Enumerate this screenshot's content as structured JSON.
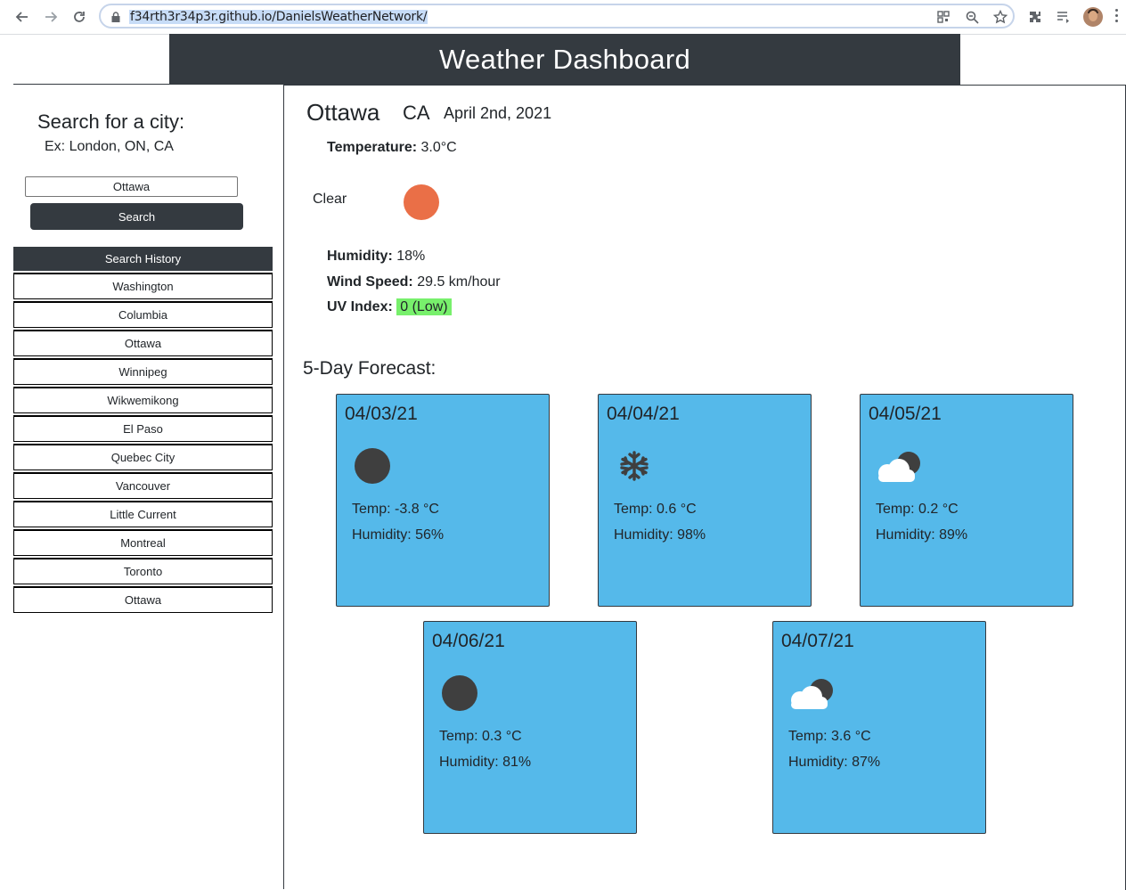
{
  "browser": {
    "url": "f34rth3r34p3r.github.io/DanielsWeatherNetwork/"
  },
  "header": {
    "title": "Weather Dashboard"
  },
  "sidebar": {
    "title": "Search for a city:",
    "example": "Ex: London, ON, CA",
    "search_value": "Ottawa",
    "search_button": "Search",
    "history_title": "Search History",
    "history": [
      "Washington",
      "Columbia",
      "Ottawa",
      "Winnipeg",
      "Wikwemikong",
      "El Paso",
      "Quebec City",
      "Vancouver",
      "Little Current",
      "Montreal",
      "Toronto",
      "Ottawa"
    ]
  },
  "current": {
    "city": "Ottawa",
    "country": "CA",
    "date": "April 2nd, 2021",
    "temperature_label": "Temperature:",
    "temperature_value": "3.0°C",
    "condition": "Clear",
    "condition_icon": "sun-icon",
    "humidity_label": "Humidity:",
    "humidity_value": "18%",
    "wind_label": "Wind Speed:",
    "wind_value": "29.5 km/hour",
    "uv_label": "UV Index:",
    "uv_value": "0 (Low)",
    "uv_color": "#78f06c",
    "sun_color": "#ea6f47"
  },
  "forecast": {
    "title": "5-Day Forecast:",
    "card_color": "#55b9ea",
    "days": [
      {
        "date": "04/03/21",
        "icon": "moon-icon",
        "temp": "Temp: -3.8 °C",
        "humidity": "Humidity: 56%"
      },
      {
        "date": "04/04/21",
        "icon": "snowflake-icon",
        "temp": "Temp: 0.6 °C",
        "humidity": "Humidity: 98%"
      },
      {
        "date": "04/05/21",
        "icon": "cloud-moon-icon",
        "temp": "Temp: 0.2 °C",
        "humidity": "Humidity: 89%"
      },
      {
        "date": "04/06/21",
        "icon": "moon-icon",
        "temp": "Temp: 0.3 °C",
        "humidity": "Humidity: 81%"
      },
      {
        "date": "04/07/21",
        "icon": "cloud-moon-icon",
        "temp": "Temp: 3.6 °C",
        "humidity": "Humidity: 87%"
      }
    ]
  }
}
